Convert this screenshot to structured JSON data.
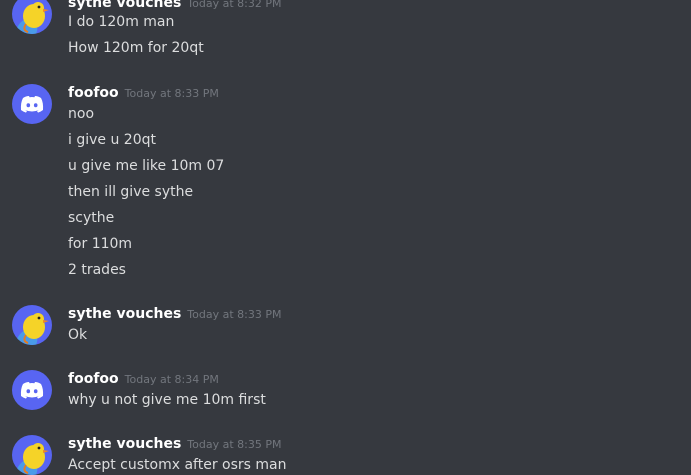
{
  "colors": {
    "background": "#36393f",
    "username": "#ffffff",
    "timestamp": "#72767d",
    "message_text": "#dcddde",
    "discord_blurple": "#5865f2"
  },
  "groups": [
    {
      "author": "sythe vouches",
      "timestamp": "Today at 8:32 PM",
      "avatar_icon": "duck-avatar-icon",
      "lines": [
        "I do 120m man",
        "How 120m for 20qt"
      ]
    },
    {
      "author": "foofoo",
      "timestamp": "Today at 8:33 PM",
      "avatar_icon": "discord-logo-icon",
      "lines": [
        "noo",
        "i give u 20qt",
        "u give me like 10m 07",
        "then ill give sythe",
        "scythe",
        "for 110m",
        "2 trades"
      ]
    },
    {
      "author": "sythe vouches",
      "timestamp": "Today at 8:33 PM",
      "avatar_icon": "duck-avatar-icon",
      "lines": [
        "Ok"
      ]
    },
    {
      "author": "foofoo",
      "timestamp": "Today at 8:34 PM",
      "avatar_icon": "discord-logo-icon",
      "lines": [
        "why u not give me 10m first"
      ]
    },
    {
      "author": "sythe vouches",
      "timestamp": "Today at 8:35 PM",
      "avatar_icon": "duck-avatar-icon",
      "lines": [
        "Accept customx after osrs man"
      ]
    }
  ]
}
